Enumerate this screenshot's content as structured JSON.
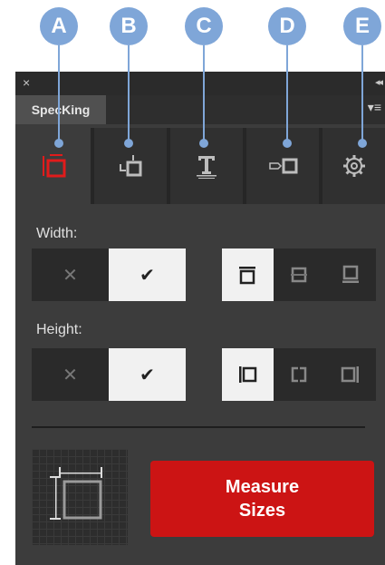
{
  "callouts": [
    "A",
    "B",
    "C",
    "D",
    "E"
  ],
  "panel": {
    "close_glyph": "×",
    "collapse_glyph": "◂◂",
    "title": "SpecKing",
    "menu_glyph": "▾≡"
  },
  "toolbar": {
    "tools": [
      {
        "name": "size-tool-icon",
        "active": true
      },
      {
        "name": "spacing-tool-icon",
        "active": false
      },
      {
        "name": "text-tool-icon",
        "active": false
      },
      {
        "name": "shape-tool-icon",
        "active": false
      },
      {
        "name": "gear-icon",
        "active": false
      }
    ],
    "accent": "#e11b1b"
  },
  "width": {
    "label": "Width:",
    "toggle": {
      "off_glyph": "✕",
      "on_glyph": "✔",
      "selected": "on"
    },
    "positions": {
      "selected": "top",
      "options": [
        "top",
        "middle",
        "bottom"
      ]
    }
  },
  "height": {
    "label": "Height:",
    "toggle": {
      "off_glyph": "✕",
      "on_glyph": "✔",
      "selected": "on"
    },
    "positions": {
      "selected": "left",
      "options": [
        "left",
        "center",
        "right"
      ]
    }
  },
  "measure_button": {
    "line1": "Measure",
    "line2": "Sizes",
    "color": "#cc1414"
  },
  "callout_color": "#7fa6d8"
}
